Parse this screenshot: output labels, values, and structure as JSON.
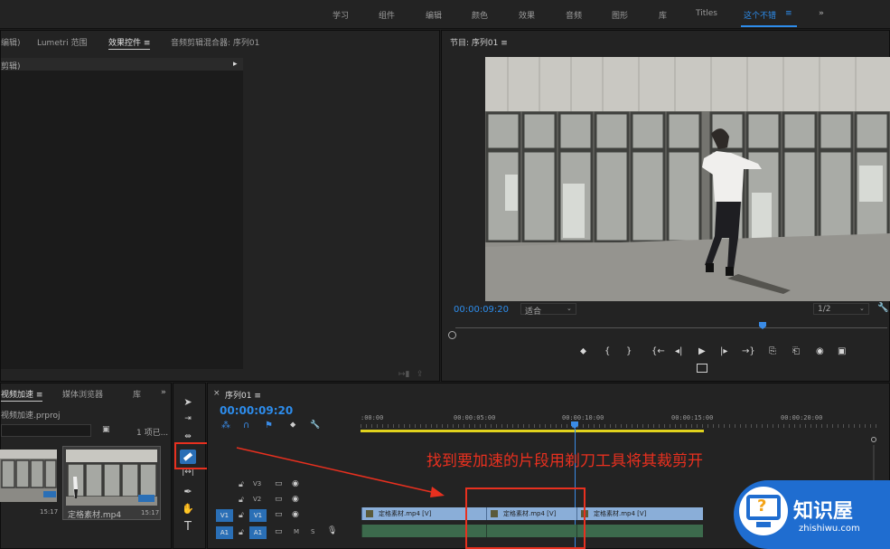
{
  "workspaces": [
    "学习",
    "组件",
    "编辑",
    "颜色",
    "效果",
    "音频",
    "图形",
    "库",
    "Titles",
    "这个不错",
    "≡",
    "»"
  ],
  "effects_panel": {
    "tabs": [
      "编辑)",
      "Lumetri 范围",
      "效果控件 ≡",
      "音频剪辑混合器: 序列01"
    ],
    "clip_row_label": "剪辑)",
    "arrow": "▸"
  },
  "program_monitor": {
    "title": "节目: 序列01 ≡",
    "timecode": "00:00:09:20",
    "fit": "适合",
    "resolution": "1/2",
    "controls": [
      "⬥",
      "{",
      "}",
      "{←",
      "◂|",
      "▶",
      "|▸",
      "→}",
      "⎘",
      "⎗",
      "◉",
      "▣"
    ]
  },
  "project_panel": {
    "tabs": [
      "视频加速 ≡",
      "媒体浏览器",
      "库",
      "»"
    ],
    "project_file": "视频加速.prproj",
    "item_count": "1 项已...",
    "clip_duration": "15:17",
    "clip_name": "定格素材.mp4",
    "clip_duration_2": "15:17"
  },
  "timeline": {
    "tab_close": "×",
    "tab": "序列01 ≡",
    "timecode": "00:00:09:20",
    "ruler": [
      ":00:00",
      "00:00:05:00",
      "00:00:10:00",
      "00:00:15:00",
      "00:00:20:00"
    ],
    "tracks": [
      "V3",
      "V2",
      "V1",
      "A1"
    ],
    "src_v": "V1",
    "src_a": "A1",
    "m": "M",
    "s": "S",
    "clips": [
      "定格素材.mp4 [V]",
      "定格素材.mp4 [V]",
      "定格素材.mp4 [V]"
    ]
  },
  "annotation": {
    "text": "找到要加速的片段用剃刀工具将其裁剪开",
    "color": "#e8301f"
  },
  "watermark": {
    "name": "知识屋",
    "url": "zhishiwu.com"
  },
  "colors": {
    "accent": "#2d8ceb",
    "playhead": "#3a8be6",
    "clip_blue": "#8aaed8",
    "annotation_red": "#e8301f"
  }
}
